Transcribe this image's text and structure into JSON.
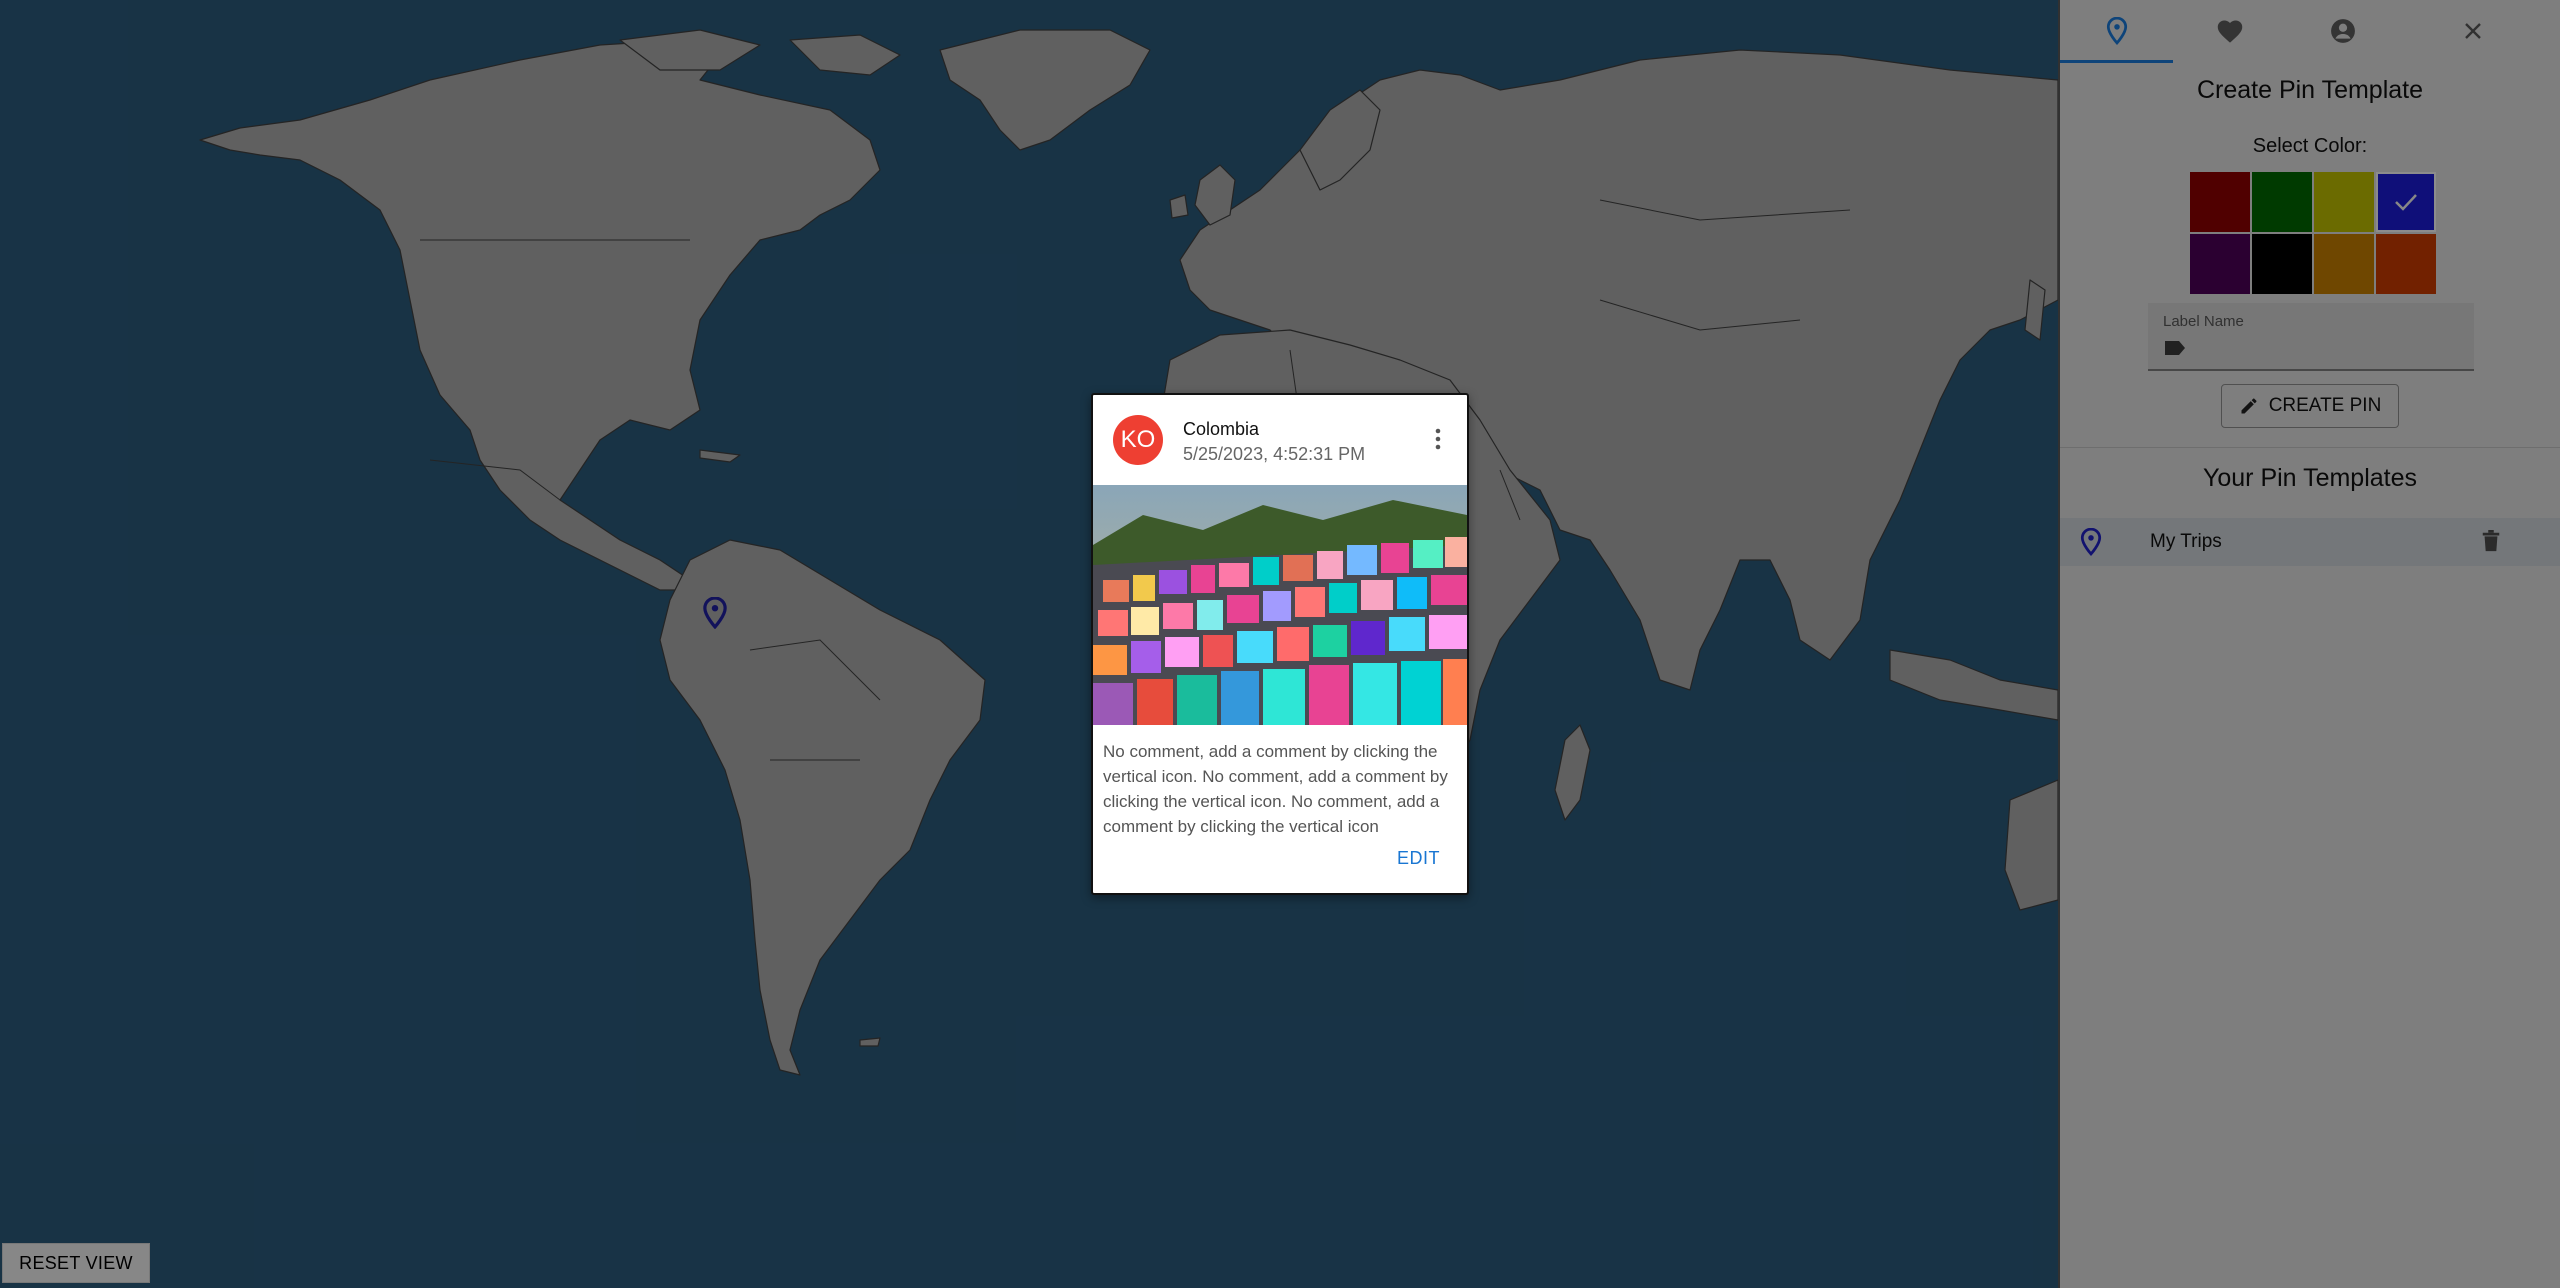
{
  "map": {
    "reset_view_label": "RESET VIEW",
    "pin_icon": "map-pin-icon",
    "ocean_color": "#2a5878",
    "land_color": "#a5a5a5"
  },
  "panel": {
    "tabs": [
      {
        "icon": "pin-icon",
        "selected": true
      },
      {
        "icon": "heart-icon",
        "selected": false
      },
      {
        "icon": "account-icon",
        "selected": false
      }
    ],
    "close_icon": "close-icon",
    "create_title": "Create Pin Template",
    "select_color_label": "Select Color:",
    "colors": [
      "#8b0000",
      "#006400",
      "#b8b800",
      "#1a1ad0",
      "#4b0055",
      "#000000",
      "#c07a00",
      "#c43a00"
    ],
    "selected_color_index": 3,
    "label_field": {
      "label": "Label Name",
      "value": ""
    },
    "create_button_label": "CREATE PIN",
    "templates_title": "Your Pin Templates",
    "templates": [
      {
        "name": "My Trips",
        "color": "#1a1ad0"
      }
    ]
  },
  "card": {
    "avatar_initials": "KO",
    "title": "Colombia",
    "subtitle": "5/25/2023, 4:52:31 PM",
    "comment": "No comment, add a comment by clicking the vertical icon. No comment, add a comment by clicking the vertical icon. No comment, add a comment by clicking the vertical icon",
    "edit_label": "EDIT"
  }
}
